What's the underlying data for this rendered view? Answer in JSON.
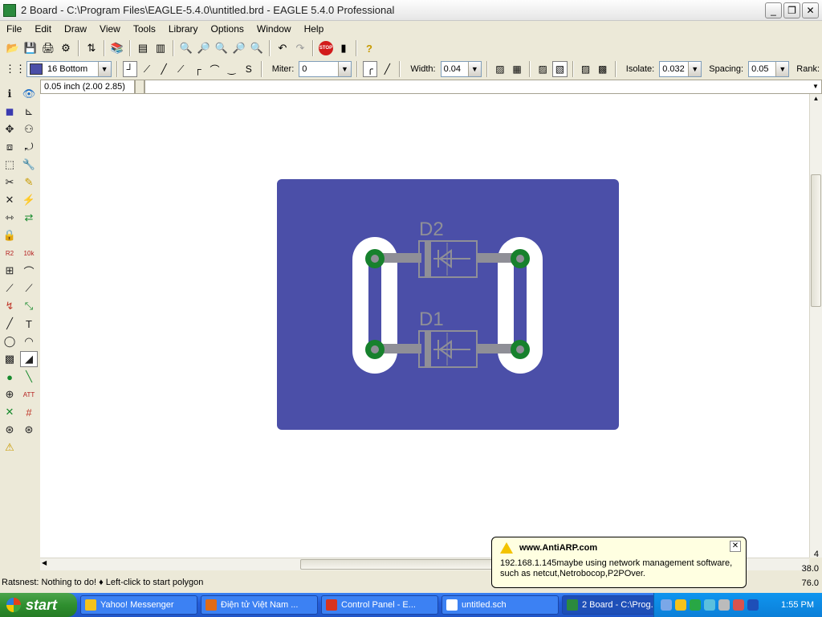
{
  "window": {
    "title": "2 Board - C:\\Program Files\\EAGLE-5.4.0\\untitled.brd - EAGLE 5.4.0 Professional",
    "minimize": "_",
    "maximize": "❐",
    "close": "✕"
  },
  "menu": [
    "File",
    "Edit",
    "Draw",
    "View",
    "Tools",
    "Library",
    "Options",
    "Window",
    "Help"
  ],
  "toolbar": {
    "stop_label": "STOP",
    "help_glyph": "?"
  },
  "params": {
    "layer": "16 Bottom",
    "miter_label": "Miter:",
    "miter_value": "0",
    "width_label": "Width:",
    "width_value": "0.04",
    "isolate_label": "Isolate:",
    "isolate_value": "0.032",
    "spacing_label": "Spacing:",
    "spacing_value": "0.05",
    "rank_label": "Rank:"
  },
  "coordinates": "0.05 inch (2.00 2.85)",
  "board": {
    "components": [
      {
        "name": "D2"
      },
      {
        "name": "D1"
      }
    ],
    "colors": {
      "polygon": "#4b4fa8",
      "pad": "#17812d",
      "trace": "#8f8f97",
      "clearance": "#ffffff"
    }
  },
  "status": "Ratsnest: Nothing to do!  ♦ Left-click to start polygon",
  "notification": {
    "title": "www.AntiARP.com",
    "message": "192.168.1.145maybe using network management software, such as netcut,Netrobocop,P2POver."
  },
  "readouts": [
    "4",
    "38.0",
    "76.0"
  ],
  "taskbar": {
    "start": "start",
    "tasks": [
      {
        "label": "Yahoo! Messenger",
        "color": "#f4c21b"
      },
      {
        "label": "Điện tử Việt Nam ...",
        "color": "#e06b16"
      },
      {
        "label": "Control Panel - E...",
        "color": "#d8331e"
      },
      {
        "label": "untitled.sch",
        "color": "#ffffff"
      },
      {
        "label": "2 Board - C:\\Prog...",
        "color": "#2b8a3e"
      }
    ],
    "clock": "1:55 PM"
  }
}
